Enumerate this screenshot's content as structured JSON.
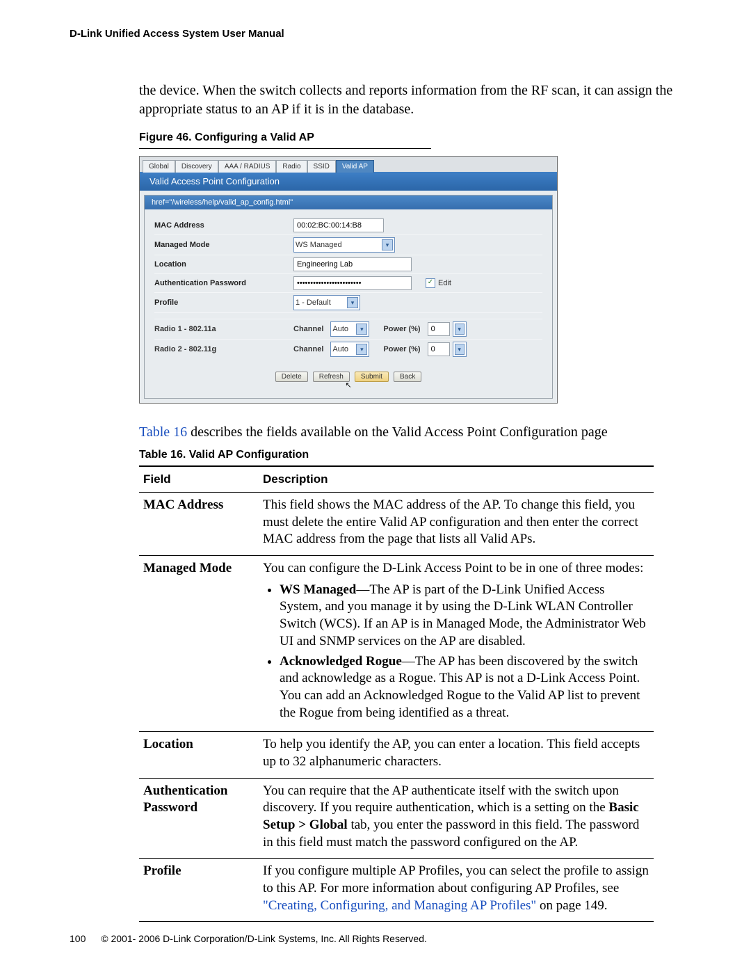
{
  "header": {
    "title": "D-Link Unified Access System User Manual"
  },
  "intro": "the device. When the switch collects and reports information from the RF scan, it can assign the appropriate status to an AP if it is in the database.",
  "figure": {
    "caption": "Figure 46.  Configuring a Valid AP"
  },
  "ui": {
    "tabs": {
      "global": "Global",
      "discovery": "Discovery",
      "aaa": "AAA / RADIUS",
      "radio": "Radio",
      "ssid": "SSID",
      "valid_ap": "Valid AP"
    },
    "panel_title": "Valid Access Point Configuration",
    "help_href": "href=\"/wireless/help/valid_ap_config.html\"",
    "rows": {
      "mac_label": "MAC Address",
      "mac_value": "00:02:BC:00:14:B8",
      "mode_label": "Managed Mode",
      "mode_value": "WS Managed",
      "location_label": "Location",
      "location_value": "Engineering Lab",
      "auth_label": "Authentication Password",
      "auth_value": "••••••••••••••••••••••••",
      "edit_label": "Edit",
      "profile_label": "Profile",
      "profile_value": "1 - Default"
    },
    "radios": {
      "r1_label": "Radio 1 - 802.11a",
      "r2_label": "Radio 2 - 802.11g",
      "channel_label": "Channel",
      "channel_value": "Auto",
      "power_label": "Power (%)",
      "power_value": "0"
    },
    "buttons": {
      "delete": "Delete",
      "refresh": "Refresh",
      "submit": "Submit",
      "back": "Back"
    }
  },
  "ref_text_prefix": "Table 16",
  "ref_text_rest": " describes the fields available on the Valid Access Point Configuration page",
  "table_caption": "Table 16. Valid AP Configuration",
  "table": {
    "h_field": "Field",
    "h_desc": "Description",
    "mac_f": "MAC Address",
    "mac_d": "This field shows the MAC address of the AP. To change this field, you must delete the entire Valid AP configuration and then enter the correct MAC address from the page that lists all Valid APs.",
    "mode_f": "Managed Mode",
    "mode_intro": "You can configure the D-Link Access Point to be in one of three modes:",
    "mode_b1_head": "WS Managed",
    "mode_b1_body": "—The AP is part of the D-Link Unified Access System, and you manage it by using the D-Link WLAN Controller Switch (WCS). If an AP is in Managed Mode, the Administrator Web UI and SNMP services on the AP are disabled.",
    "mode_b2_head": "Acknowledged Rogue",
    "mode_b2_body": "—The AP has been discovered by the switch and acknowledge as a Rogue. This AP is not a D-Link Access Point. You can add an Acknowledged Rogue to the Valid AP list to prevent the Rogue from being identified as a threat.",
    "loc_f": "Location",
    "loc_d": "To help you identify the AP, you can enter a location. This field accepts up to 32 alphanumeric characters.",
    "auth_f": "Authentication Password",
    "auth_d1": "You can require that the AP authenticate itself with the switch upon discovery. If you require authentication, which is a setting on the ",
    "auth_bold": "Basic Setup > Global",
    "auth_d2": " tab, you enter the password in this field. The password in this field must match the password configured on the AP.",
    "prof_f": "Profile",
    "prof_d1": "If you configure multiple AP Profiles, you can select the profile to assign to this AP. For more information about configuring AP Profiles, see ",
    "prof_link": "\"Creating, Configuring, and Managing AP Profiles\"",
    "prof_d2": " on page 149."
  },
  "footer": {
    "page": "100",
    "copyright": "© 2001- 2006 D-Link Corporation/D-Link Systems, Inc. All Rights Reserved."
  }
}
